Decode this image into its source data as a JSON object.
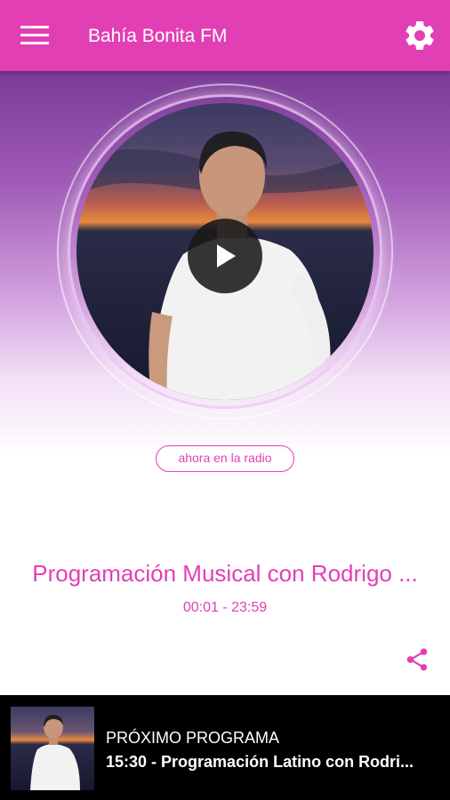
{
  "app": {
    "title": "Bahía Bonita FM",
    "accent_color": "#e23fb5"
  },
  "icons": {
    "menu": "hamburger-menu-icon",
    "settings": "gear-icon",
    "play": "play-icon",
    "share": "share-icon"
  },
  "now_playing": {
    "badge": "ahora en la radio",
    "title": "Programación Musical con Rodrigo ...",
    "time": "00:01 - 23:59"
  },
  "next_program": {
    "label": "PRÓXIMO PROGRAMA",
    "title": "15:30 - Programación Latino con Rodri..."
  }
}
